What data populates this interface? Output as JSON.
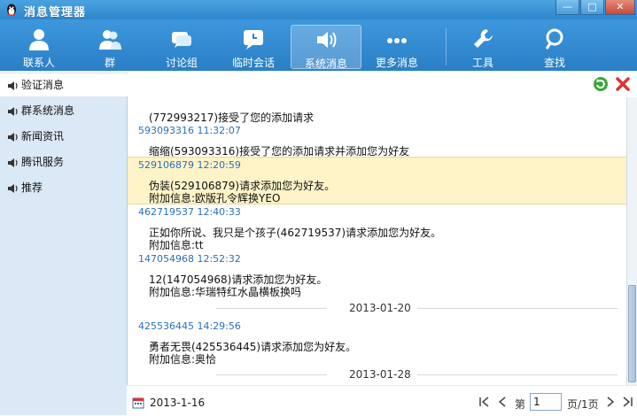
{
  "window": {
    "title": "消息管理器",
    "minimize": "—",
    "maximize": "□",
    "close": "✕"
  },
  "toolbar": {
    "items": [
      {
        "label": "联系人",
        "icon": "contact-icon"
      },
      {
        "label": "群",
        "icon": "group-icon"
      },
      {
        "label": "讨论组",
        "icon": "discussion-icon"
      },
      {
        "label": "临时会话",
        "icon": "temp-chat-icon"
      },
      {
        "label": "系统消息",
        "icon": "speaker-icon",
        "active": true
      },
      {
        "label": "更多消息",
        "icon": "more-icon"
      },
      {
        "label": "工具",
        "icon": "wrench-icon"
      },
      {
        "label": "查找",
        "icon": "search-icon"
      }
    ]
  },
  "sidebar": {
    "items": [
      {
        "label": "验证消息",
        "selected": true
      },
      {
        "label": "群系统消息"
      },
      {
        "label": "新闻资讯"
      },
      {
        "label": "腾讯服务"
      },
      {
        "label": "推荐"
      }
    ]
  },
  "messages": {
    "m0_line1": "(772993217)接受了您的添加请求",
    "m1_head": "593093316 11:32:07",
    "m1_line1": "缩缩(593093316)接受了您的添加请求并添加您为好友",
    "m2_head": "529106879 12:20:59",
    "m2_line1": "伪装(529106879)请求添加您为好友。",
    "m2_line2": "附加信息:欧版孔令辉换YEO",
    "m3_head": "462719537 12:40:33",
    "m3_line1": "正如你所说、我只是个孩子(462719537)请求添加您为好友。",
    "m3_line2": "附加信息:tt",
    "m4_head": "147054968 12:52:32",
    "m4_line1": "12(147054968)请求添加您为好友。",
    "m4_line2": "附加信息:华瑞特红水晶横板换吗",
    "date1": "2013-01-20",
    "m5_head": "425536445 14:29:56",
    "m5_line1": "勇者无畏(425536445)请求添加您为好友。",
    "m5_line2": "附加信息:奥恰",
    "date2": "2013-01-28"
  },
  "footer": {
    "date": "2013-1-16",
    "page_prefix": "第",
    "page_value": "1",
    "page_suffix": "页/1页"
  },
  "colors": {
    "accent": "#2f86cd",
    "highlight": "#fff3c8",
    "sidebar": "#dbe8f5",
    "header_blue": "#2a6fbd"
  }
}
